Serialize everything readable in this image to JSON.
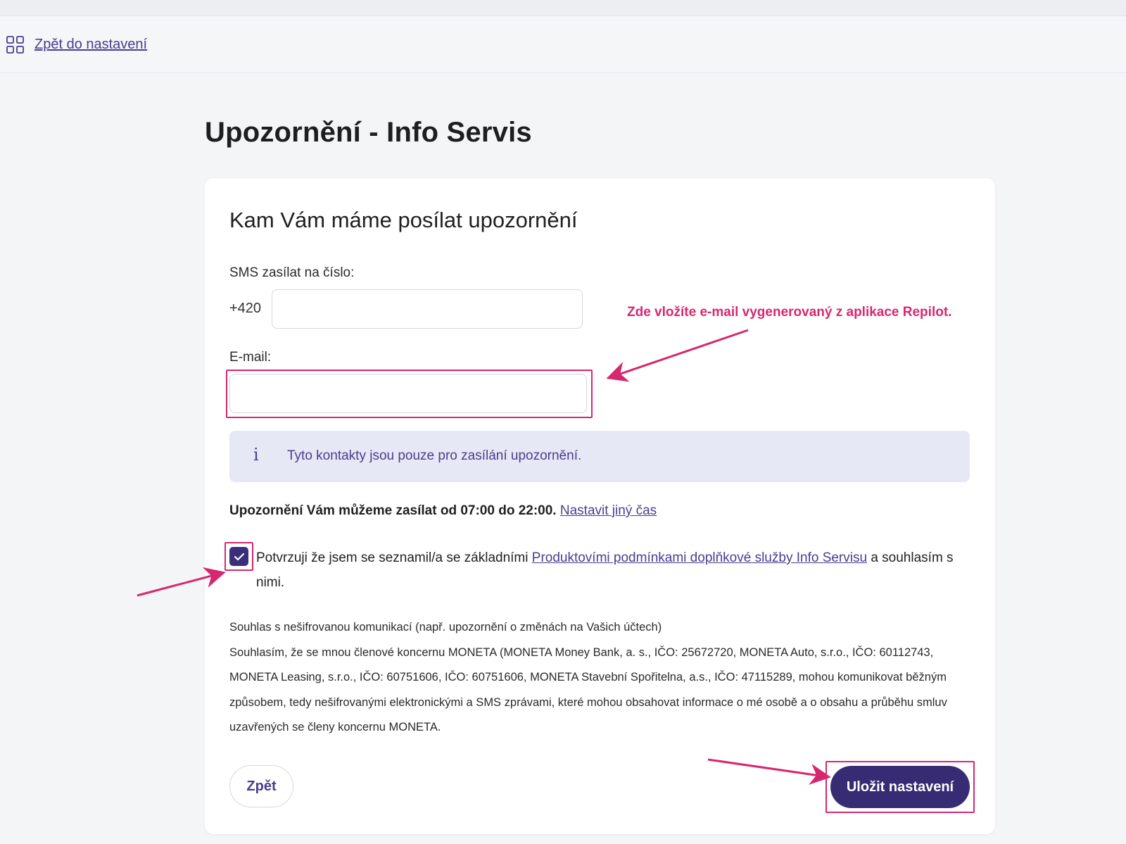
{
  "nav": {
    "back_label": "Zpět do nastavení"
  },
  "page": {
    "title": "Upozornění - Info Servis"
  },
  "card": {
    "title": "Kam Vám máme posílat upozornění",
    "sms_label": "SMS zasílat na číslo:",
    "phone_prefix": "+420",
    "phone_value": "",
    "email_label": "E-mail:",
    "email_value": "",
    "info_text": "Tyto kontakty jsou pouze pro zasílání upozornění.",
    "time_text": "Upozornění Vám můžeme zasílat od 07:00 do 22:00.",
    "time_link": "Nastavit jiný čas",
    "consent_checked": true,
    "consent_before": "Potvrzuji že jsem se seznamil/a se základními ",
    "consent_link": "Produktovími podmínkami doplňkové služby Info Servisu",
    "consent_after": " a souhlasím s nimi.",
    "legal_heading": "Souhlas s nešifrovanou komunikací (např. upozornění o změnách na Vašich účtech)",
    "legal_body": "Souhlasím, že se mnou členové koncernu MONETA (MONETA Money Bank, a. s., IČO: 25672720, MONETA Auto, s.r.o., IČO: 60112743, MONETA Leasing, s.r.o., IČO: 60751606, IČO: 60751606, MONETA Stavební Spořitelna, a.s., IČO: 47115289, mohou komunikovat běžným způsobem, tedy nešifrovanými elektronickými a SMS zprávami, které mohou obsahovat informace o mé osobě a o obsahu a průběhu smluv uzavřených se členy koncernu MONETA.",
    "back_button": "Zpět",
    "save_button": "Uložit nastavení"
  },
  "annotation": {
    "text": "Zde vložíte e-mail vygenerovaný z aplikace Repilot."
  },
  "colors": {
    "accent": "#372b74",
    "link": "#4a3d8f",
    "annotation": "#d6286f",
    "info_bg": "#e6e8f5"
  },
  "icons": {
    "nav": "grid-icon",
    "info": "info-icon",
    "checkbox": "checkmark-icon"
  }
}
